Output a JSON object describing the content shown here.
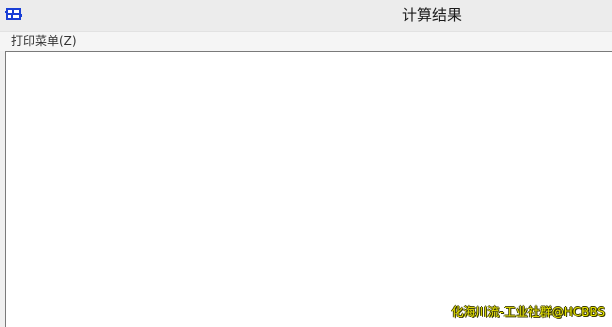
{
  "window": {
    "title": "计算结果",
    "icon": "app-chip-icon"
  },
  "menubar": {
    "items": [
      {
        "label": "打印菜单(Z)"
      }
    ]
  },
  "content": {
    "text": ""
  },
  "watermark": {
    "text": "化海川流-工业社群@HCBBS"
  },
  "colors": {
    "titlebar_bg": "#ececec",
    "content_bg": "#ffffff",
    "icon_blue": "#1a3fd6",
    "watermark_fill": "#e8e400"
  }
}
